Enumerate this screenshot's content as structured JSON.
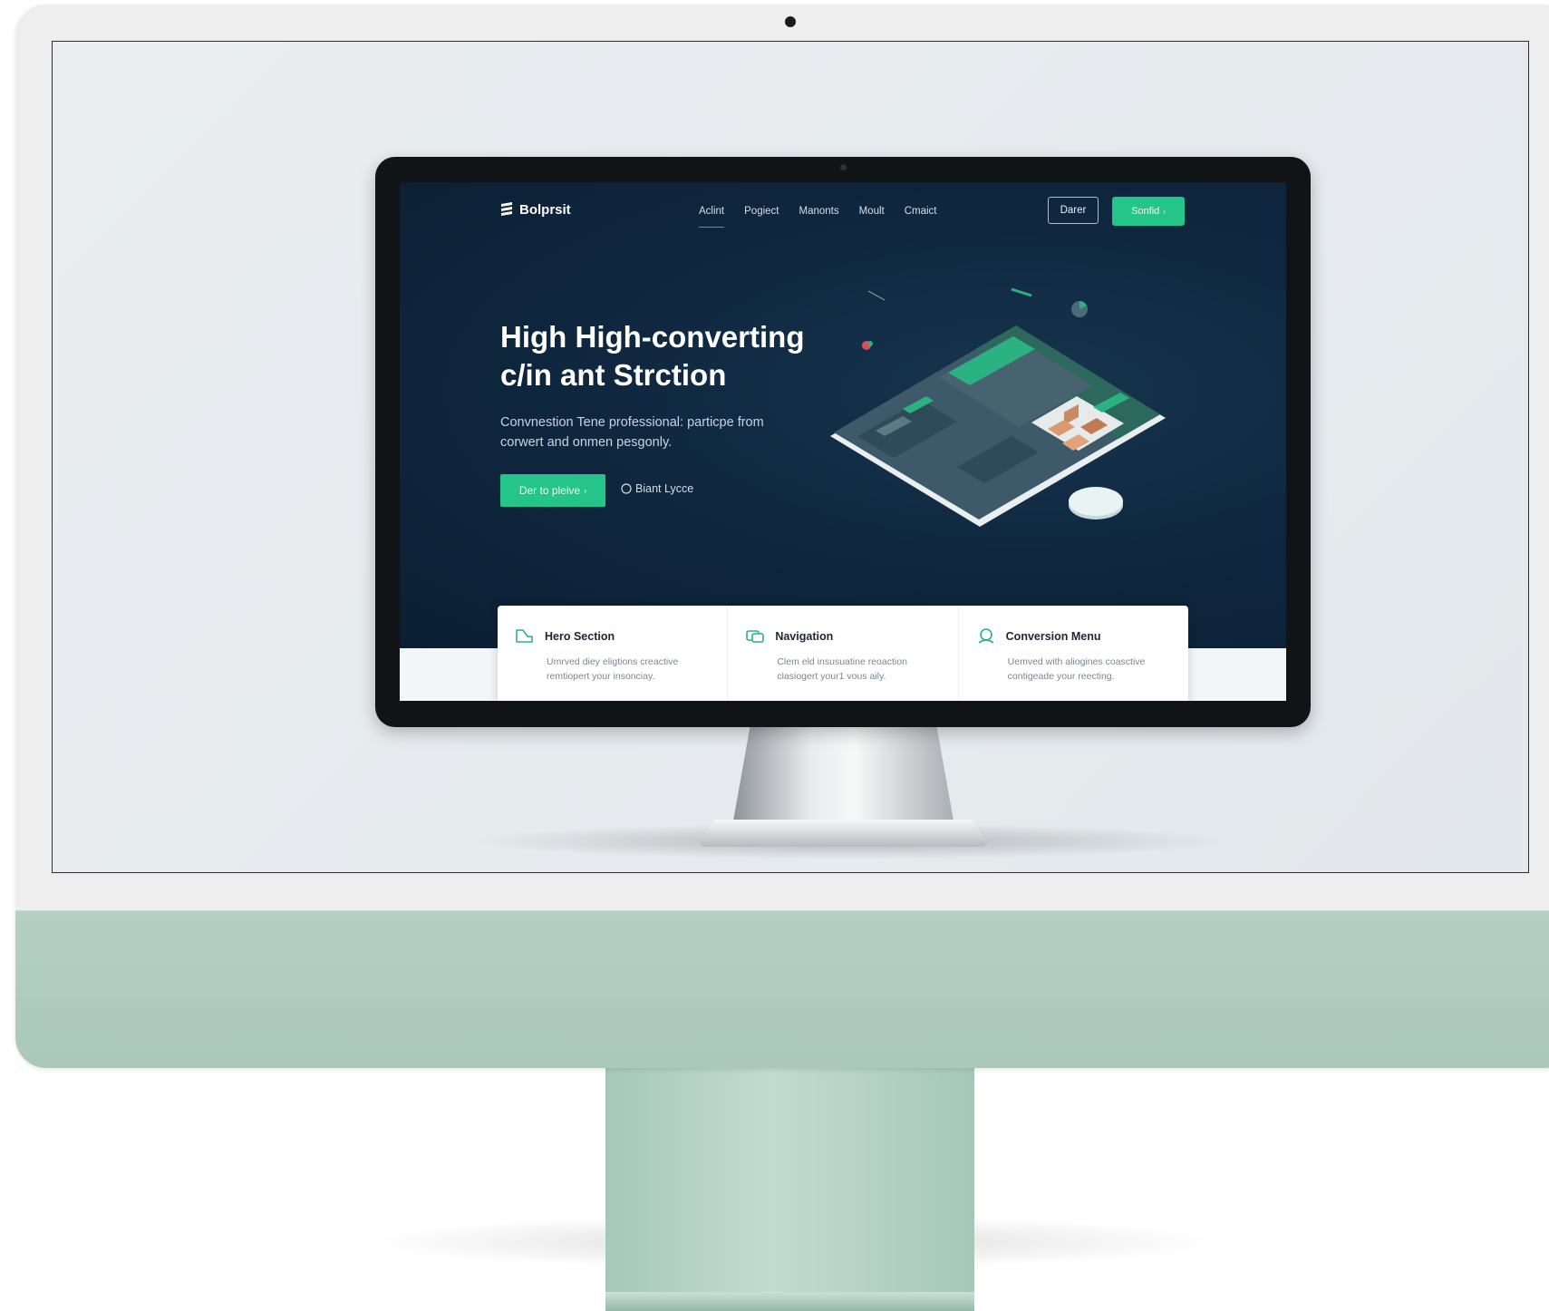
{
  "website": {
    "logo_text": "Bolprsit",
    "nav_links": [
      "Aclint",
      "Pogiect",
      "Manonts",
      "Moult",
      "Cmaict"
    ],
    "nav_outline_button": "Darer",
    "nav_primary_button": "Sonfid",
    "hero": {
      "title_line1": "High High-converting",
      "title_line2": "c/in ant Strction",
      "subtitle_line1": "Convnestion Tene professional: particpe from",
      "subtitle_line2": "corwert and onmen pesgonly.",
      "cta_label": "Der to pleive",
      "secondary_label": "Biant Lycce"
    },
    "cards": [
      {
        "title": "Hero Section",
        "desc_line1": "Umrved diey eligtions creactive",
        "desc_line2": "remtiopert your insonciay.",
        "icon": "hero-section-icon"
      },
      {
        "title": "Navigation",
        "desc_line1": "Clem eld insusuatine reoaction",
        "desc_line2": "clasiogert your1 vous aily.",
        "icon": "navigation-icon"
      },
      {
        "title": "Conversion Menu",
        "desc_line1": "Uemved with aliogines coasctive",
        "desc_line2": "contigeade your reecting.",
        "icon": "conversion-menu-icon"
      }
    ]
  },
  "colors": {
    "accent_green": "#25c488",
    "hero_navy": "#0f2840",
    "imac_green": "#aac8bb"
  }
}
